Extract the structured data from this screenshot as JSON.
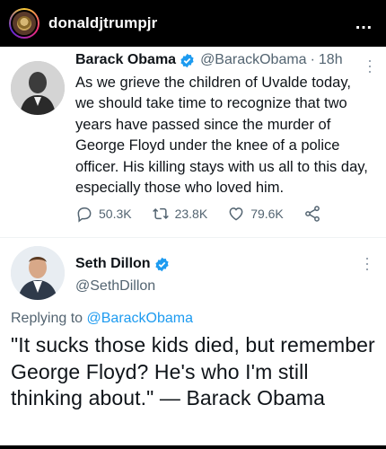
{
  "instagram": {
    "username": "donaldjtrumpjr",
    "more_label": "…"
  },
  "tweet1": {
    "name": "Barack Obama",
    "handle": "@BarackObama",
    "separator": "·",
    "time": "18h",
    "text": "As we grieve the children of Uvalde today, we should take time to recognize that two years have passed since the murder of George Floyd under the knee of a police officer. His killing stays with us all to this day, especially those who loved him.",
    "replies": "50.3K",
    "retweets": "23.8K",
    "likes": "79.6K"
  },
  "tweet2": {
    "name": "Seth Dillon",
    "handle": "@SethDillon",
    "replying_prefix": "Replying to ",
    "replying_to": "@BarackObama",
    "text": "\"It sucks those kids died, but remember George Floyd? He's who I'm still thinking about.\" — Barack Obama"
  },
  "colors": {
    "verified": "#1d9bf0",
    "icon_gray": "#536471",
    "mention": "#1d9bf0"
  },
  "icons": [
    "reply-icon",
    "retweet-icon",
    "like-icon",
    "share-icon",
    "verified-badge-icon",
    "more-icon"
  ]
}
